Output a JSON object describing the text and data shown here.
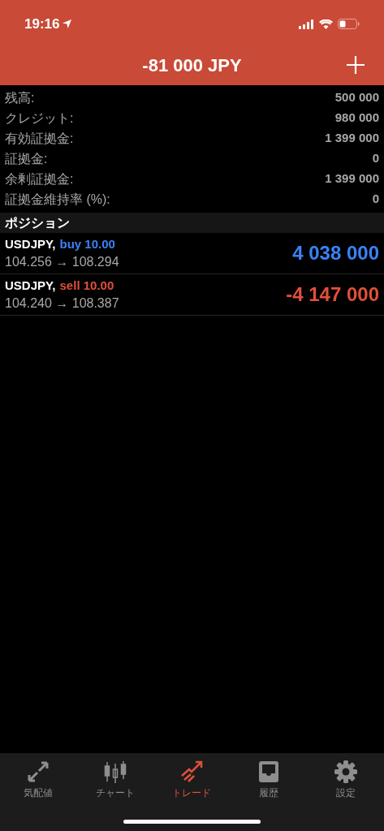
{
  "status_bar": {
    "time": "19:16"
  },
  "header": {
    "title": "-81 000 JPY"
  },
  "account": [
    {
      "label": "残高:",
      "value": "500 000"
    },
    {
      "label": "クレジット:",
      "value": "980 000"
    },
    {
      "label": "有効証拠金:",
      "value": "1 399 000"
    },
    {
      "label": "証拠金:",
      "value": "0"
    },
    {
      "label": "余剰証拠金:",
      "value": "1 399 000"
    },
    {
      "label": "証拠金維持率 (%):",
      "value": "0"
    }
  ],
  "positions": {
    "title": "ポジション",
    "items": [
      {
        "symbol": "USDJPY,",
        "side": "buy 10.00",
        "kind": "buy",
        "prices": "104.256 → 108.294",
        "profit": "4 038 000"
      },
      {
        "symbol": "USDJPY,",
        "side": "sell 10.00",
        "kind": "sell",
        "prices": "104.240 → 108.387",
        "profit": "-4 147 000"
      }
    ]
  },
  "tab_bar": [
    {
      "label": "気配値",
      "kind": "quotes",
      "selected": false
    },
    {
      "label": "チャート",
      "kind": "chart",
      "selected": false
    },
    {
      "label": "トレード",
      "kind": "trade",
      "selected": true
    },
    {
      "label": "履歴",
      "kind": "history",
      "selected": false
    },
    {
      "label": "設定",
      "kind": "settings",
      "selected": false
    }
  ]
}
